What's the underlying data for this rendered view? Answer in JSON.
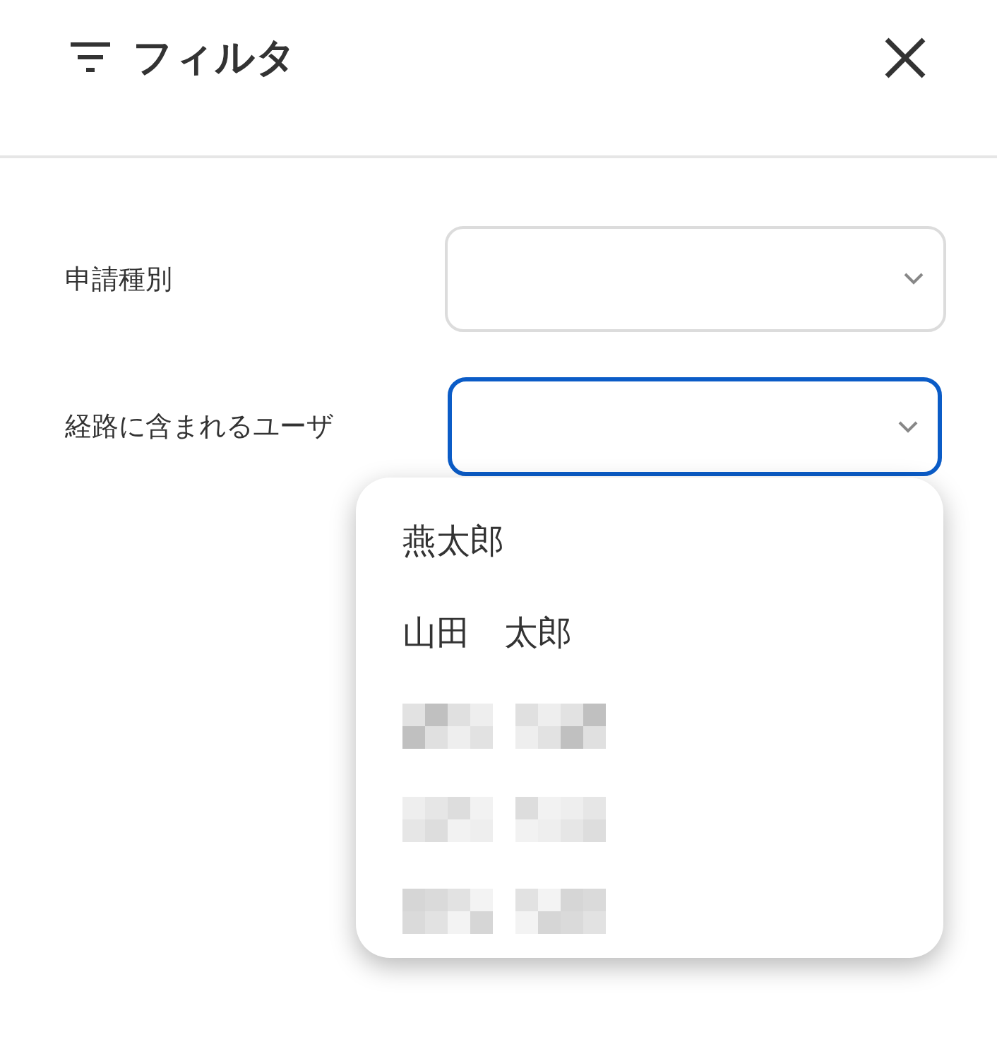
{
  "header": {
    "title": "フィルタ"
  },
  "fields": [
    {
      "label": "申請種別",
      "focused": false
    },
    {
      "label": "経路に含まれるユーザ",
      "focused": true
    }
  ],
  "dropdown": {
    "options": [
      {
        "kind": "text",
        "label": "燕太郎"
      },
      {
        "kind": "text",
        "label": "山田　太郎"
      },
      {
        "kind": "redacted"
      },
      {
        "kind": "redacted"
      },
      {
        "kind": "redacted"
      }
    ]
  }
}
